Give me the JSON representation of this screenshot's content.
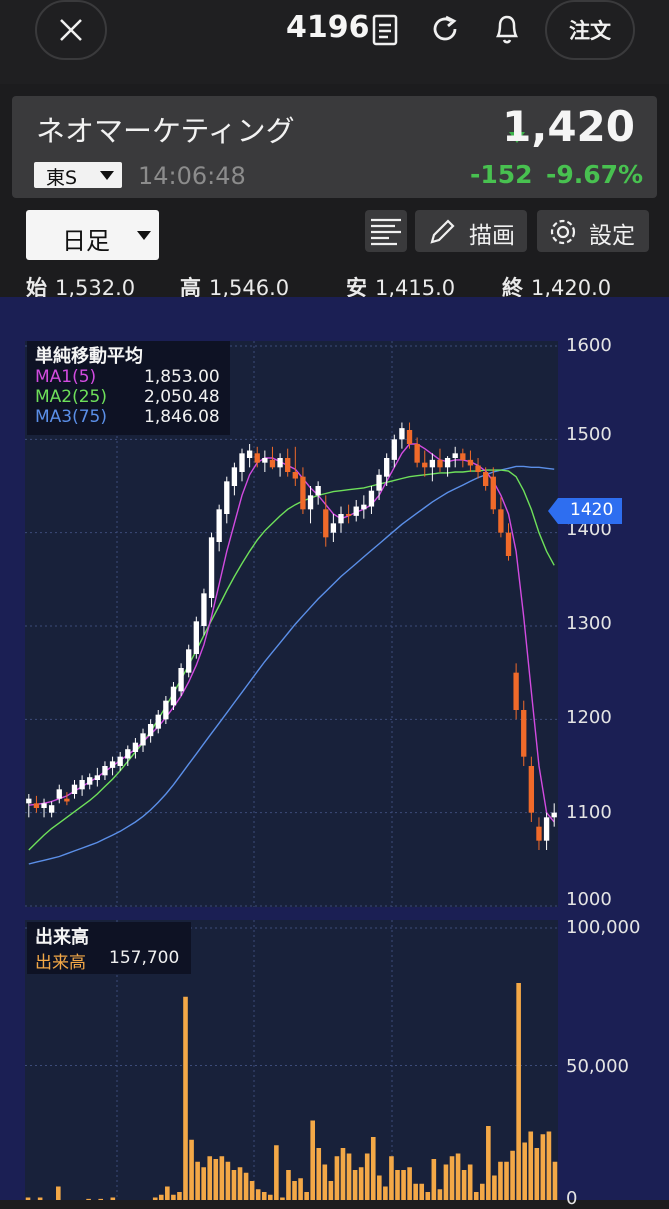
{
  "header": {
    "close_icon": "close-icon",
    "code": "4196",
    "order_label": "注文"
  },
  "stock": {
    "name": "ネオマーケティング",
    "market": "東S",
    "time": "14:06:48",
    "price": "1,420",
    "change": "-152",
    "change_pct": "-9.67%",
    "down_color": "#3cb44b"
  },
  "toolbar": {
    "period": "日足",
    "draw_label": "描画",
    "settings_label": "設定"
  },
  "ohlc": {
    "open_label": "始",
    "open": "1,532.0",
    "high_label": "高",
    "high": "1,546.0",
    "low_label": "安",
    "low": "1,415.0",
    "close_label": "終",
    "close": "1,420.0"
  },
  "price_panel": {
    "legend_title": "単純移動平均",
    "ma": [
      {
        "name": "MA1(5)",
        "value": "1,853.00",
        "color": "#d24be0"
      },
      {
        "name": "MA2(25)",
        "value": "2,050.48",
        "color": "#6ee05a"
      },
      {
        "name": "MA3(75)",
        "value": "1,846.08",
        "color": "#5b8fe8"
      }
    ],
    "y_ticks": [
      "1600",
      "1500",
      "1400",
      "1300",
      "1200",
      "1100",
      "1000"
    ],
    "current_tag": "1420"
  },
  "volume_panel": {
    "legend_title": "出来高",
    "series_name": "出来高",
    "value": "157,700",
    "y_ticks": [
      "100,000",
      "50,000",
      "0"
    ]
  },
  "chart_data": {
    "type": "candlestick",
    "ylim": [
      1000,
      1600
    ],
    "candles": [
      [
        1110,
        1120,
        1095,
        1115
      ],
      [
        1110,
        1118,
        1100,
        1105
      ],
      [
        1105,
        1115,
        1095,
        1110
      ],
      [
        1100,
        1112,
        1095,
        1108
      ],
      [
        1115,
        1130,
        1110,
        1125
      ],
      [
        1115,
        1122,
        1108,
        1112
      ],
      [
        1120,
        1135,
        1115,
        1130
      ],
      [
        1125,
        1140,
        1118,
        1135
      ],
      [
        1130,
        1142,
        1125,
        1138
      ],
      [
        1135,
        1148,
        1128,
        1140
      ],
      [
        1140,
        1155,
        1135,
        1150
      ],
      [
        1148,
        1160,
        1140,
        1155
      ],
      [
        1150,
        1165,
        1145,
        1160
      ],
      [
        1158,
        1172,
        1150,
        1168
      ],
      [
        1165,
        1180,
        1158,
        1175
      ],
      [
        1172,
        1190,
        1165,
        1185
      ],
      [
        1182,
        1200,
        1175,
        1195
      ],
      [
        1190,
        1210,
        1185,
        1205
      ],
      [
        1200,
        1225,
        1195,
        1220
      ],
      [
        1215,
        1240,
        1210,
        1235
      ],
      [
        1230,
        1260,
        1225,
        1255
      ],
      [
        1250,
        1280,
        1245,
        1275
      ],
      [
        1270,
        1310,
        1265,
        1305
      ],
      [
        1300,
        1340,
        1290,
        1335
      ],
      [
        1330,
        1400,
        1320,
        1395
      ],
      [
        1390,
        1430,
        1380,
        1425
      ],
      [
        1420,
        1460,
        1410,
        1455
      ],
      [
        1450,
        1475,
        1440,
        1470
      ],
      [
        1465,
        1490,
        1455,
        1485
      ],
      [
        1480,
        1495,
        1470,
        1488
      ],
      [
        1485,
        1492,
        1470,
        1475
      ],
      [
        1475,
        1488,
        1465,
        1480
      ],
      [
        1478,
        1492,
        1468,
        1470
      ],
      [
        1470,
        1485,
        1460,
        1480
      ],
      [
        1480,
        1490,
        1460,
        1465
      ],
      [
        1465,
        1492,
        1450,
        1458
      ],
      [
        1460,
        1470,
        1420,
        1425
      ],
      [
        1425,
        1450,
        1410,
        1440
      ],
      [
        1440,
        1455,
        1430,
        1450
      ],
      [
        1425,
        1440,
        1385,
        1395
      ],
      [
        1400,
        1420,
        1390,
        1410
      ],
      [
        1410,
        1428,
        1400,
        1420
      ],
      [
        1420,
        1430,
        1410,
        1418
      ],
      [
        1418,
        1435,
        1412,
        1428
      ],
      [
        1425,
        1440,
        1415,
        1430
      ],
      [
        1428,
        1450,
        1420,
        1445
      ],
      [
        1445,
        1468,
        1435,
        1462
      ],
      [
        1460,
        1485,
        1450,
        1480
      ],
      [
        1478,
        1505,
        1470,
        1500
      ],
      [
        1500,
        1518,
        1490,
        1512
      ],
      [
        1510,
        1518,
        1490,
        1495
      ],
      [
        1495,
        1502,
        1470,
        1475
      ],
      [
        1475,
        1488,
        1460,
        1470
      ],
      [
        1470,
        1485,
        1455,
        1478
      ],
      [
        1478,
        1490,
        1465,
        1470
      ],
      [
        1470,
        1482,
        1460,
        1480
      ],
      [
        1480,
        1492,
        1470,
        1485
      ],
      [
        1485,
        1490,
        1470,
        1478
      ],
      [
        1478,
        1488,
        1465,
        1472
      ],
      [
        1472,
        1480,
        1458,
        1465
      ],
      [
        1465,
        1470,
        1445,
        1450
      ],
      [
        1460,
        1470,
        1420,
        1425
      ],
      [
        1425,
        1438,
        1395,
        1400
      ],
      [
        1400,
        1410,
        1370,
        1375
      ],
      [
        1250,
        1260,
        1200,
        1210
      ],
      [
        1210,
        1220,
        1150,
        1160
      ],
      [
        1150,
        1160,
        1090,
        1100
      ],
      [
        1085,
        1095,
        1060,
        1070
      ],
      [
        1070,
        1100,
        1060,
        1095
      ],
      [
        1095,
        1110,
        1085,
        1100
      ]
    ],
    "ma1": [
      1108,
      1109,
      1110,
      1112,
      1115,
      1118,
      1123,
      1128,
      1133,
      1138,
      1144,
      1150,
      1156,
      1162,
      1168,
      1176,
      1184,
      1192,
      1202,
      1213,
      1225,
      1240,
      1258,
      1280,
      1310,
      1345,
      1380,
      1410,
      1440,
      1462,
      1475,
      1480,
      1480,
      1476,
      1472,
      1468,
      1458,
      1448,
      1440,
      1430,
      1420,
      1415,
      1418,
      1422,
      1425,
      1430,
      1440,
      1455,
      1470,
      1485,
      1495,
      1495,
      1490,
      1484,
      1478,
      1476,
      1478,
      1478,
      1476,
      1472,
      1466,
      1455,
      1440,
      1420,
      1380,
      1310,
      1230,
      1150,
      1100,
      1090
    ],
    "ma2": [
      1060,
      1068,
      1076,
      1083,
      1089,
      1095,
      1101,
      1107,
      1113,
      1120,
      1128,
      1136,
      1145,
      1155,
      1165,
      1175,
      1187,
      1200,
      1214,
      1228,
      1243,
      1258,
      1274,
      1290,
      1306,
      1322,
      1338,
      1353,
      1367,
      1380,
      1392,
      1402,
      1410,
      1418,
      1425,
      1430,
      1434,
      1437,
      1440,
      1442,
      1444,
      1445,
      1446,
      1447,
      1448,
      1450,
      1452,
      1454,
      1456,
      1458,
      1460,
      1461,
      1462,
      1463,
      1464,
      1464,
      1465,
      1465,
      1466,
      1466,
      1467,
      1467,
      1467,
      1466,
      1460,
      1445,
      1425,
      1400,
      1380,
      1365
    ],
    "ma3": [
      1045,
      1047,
      1049,
      1051,
      1053,
      1056,
      1059,
      1062,
      1065,
      1068,
      1072,
      1076,
      1080,
      1085,
      1090,
      1096,
      1103,
      1111,
      1120,
      1130,
      1141,
      1152,
      1163,
      1174,
      1185,
      1196,
      1207,
      1218,
      1229,
      1240,
      1251,
      1262,
      1272,
      1282,
      1292,
      1302,
      1311,
      1320,
      1329,
      1337,
      1345,
      1353,
      1360,
      1367,
      1374,
      1381,
      1388,
      1395,
      1402,
      1409,
      1415,
      1421,
      1427,
      1433,
      1438,
      1443,
      1447,
      1451,
      1455,
      1459,
      1462,
      1465,
      1467,
      1469,
      1471,
      1471,
      1470,
      1470,
      1469,
      1468
    ],
    "volume": [
      2000,
      0,
      2000,
      0,
      0,
      6000,
      0,
      0,
      0,
      0,
      1500,
      0,
      1500,
      0,
      2000,
      0,
      0,
      0,
      0,
      0,
      0,
      2000,
      3000,
      6000,
      3000,
      4000,
      75000,
      23000,
      15000,
      13000,
      17000,
      16000,
      17000,
      15000,
      12000,
      13000,
      11000,
      8000,
      5000,
      4000,
      3000,
      21000,
      2000,
      12000,
      8000,
      9000,
      4000,
      30000,
      20000,
      14000,
      8000,
      17000,
      20000,
      18000,
      12000,
      13000,
      18000,
      24000,
      10000,
      6000,
      17000,
      12000,
      12000,
      13000,
      7000,
      7000,
      4000,
      16000,
      5000,
      14000,
      17000,
      18000,
      12000,
      14000,
      4000,
      7000,
      28000,
      10000,
      15000,
      15000,
      19000,
      80000,
      22000,
      26000,
      20000,
      25000,
      26000,
      15000
    ],
    "ylim_volume": [
      0,
      100000
    ]
  }
}
